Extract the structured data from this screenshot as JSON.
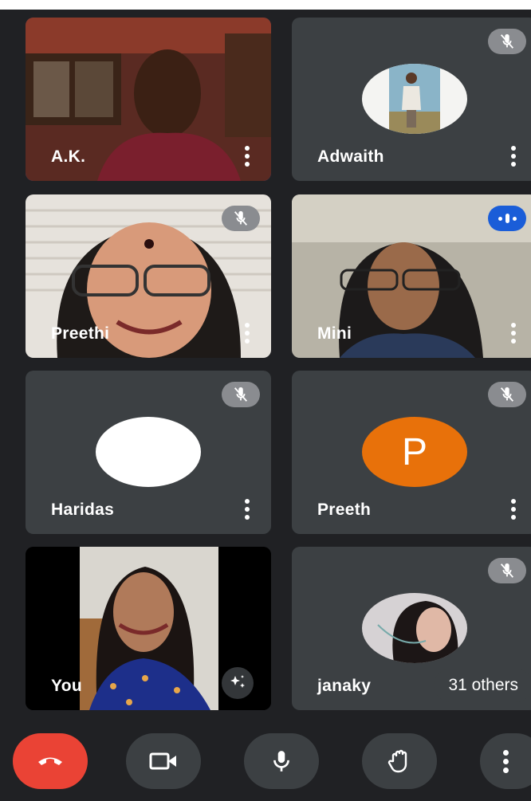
{
  "participants": [
    {
      "name": "A.K.",
      "active": true
    },
    {
      "name": "Adwaith",
      "muted": true
    },
    {
      "name": "Preethi",
      "muted": true
    },
    {
      "name": "Mini",
      "speaking": true
    },
    {
      "name": "Haridas",
      "muted": true
    },
    {
      "name": "Preeth",
      "muted": true,
      "initial": "P"
    },
    {
      "name": "You"
    },
    {
      "name": "janaky",
      "muted": true
    }
  ],
  "others_label": "31 others",
  "controls": {
    "end_call": "end-call",
    "camera": "camera",
    "mic": "microphone",
    "raise_hand": "raise-hand",
    "more": "more"
  },
  "colors": {
    "background": "#202124",
    "tile": "#3c4043",
    "end_call": "#ea4335",
    "speaking": "#1a5dd8",
    "letter_avatar": "#e8710a"
  }
}
